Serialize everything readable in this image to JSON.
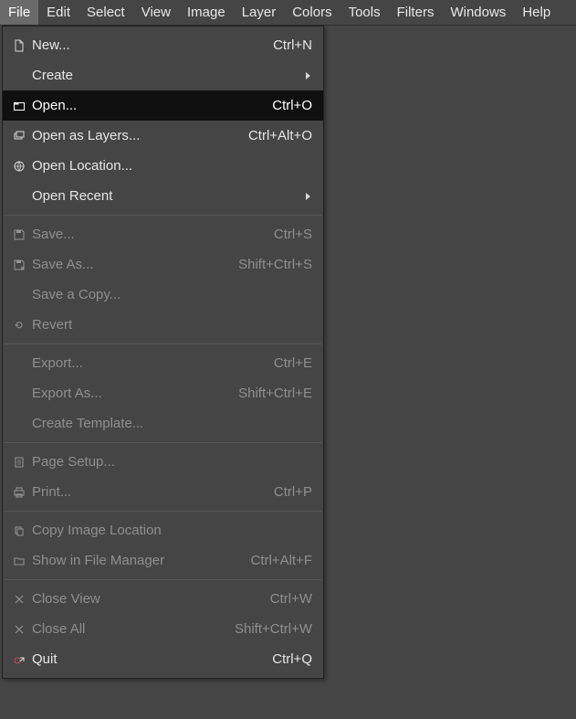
{
  "menubar": {
    "items": [
      {
        "label": "File"
      },
      {
        "label": "Edit"
      },
      {
        "label": "Select"
      },
      {
        "label": "View"
      },
      {
        "label": "Image"
      },
      {
        "label": "Layer"
      },
      {
        "label": "Colors"
      },
      {
        "label": "Tools"
      },
      {
        "label": "Filters"
      },
      {
        "label": "Windows"
      },
      {
        "label": "Help"
      }
    ],
    "active_index": 0
  },
  "file_menu": {
    "new": {
      "label": "New...",
      "accel": "Ctrl+N"
    },
    "create": {
      "label": "Create"
    },
    "open": {
      "label": "Open...",
      "accel": "Ctrl+O"
    },
    "open_as_layers": {
      "label": "Open as Layers...",
      "accel": "Ctrl+Alt+O"
    },
    "open_location": {
      "label": "Open Location..."
    },
    "open_recent": {
      "label": "Open Recent"
    },
    "save": {
      "label": "Save...",
      "accel": "Ctrl+S"
    },
    "save_as": {
      "label": "Save As...",
      "accel": "Shift+Ctrl+S"
    },
    "save_a_copy": {
      "label": "Save a Copy..."
    },
    "revert": {
      "label": "Revert"
    },
    "export": {
      "label": "Export...",
      "accel": "Ctrl+E"
    },
    "export_as": {
      "label": "Export As...",
      "accel": "Shift+Ctrl+E"
    },
    "create_template": {
      "label": "Create Template..."
    },
    "page_setup": {
      "label": "Page Setup..."
    },
    "print": {
      "label": "Print...",
      "accel": "Ctrl+P"
    },
    "copy_image_location": {
      "label": "Copy Image Location"
    },
    "show_in_file_manager": {
      "label": "Show in File Manager",
      "accel": "Ctrl+Alt+F"
    },
    "close_view": {
      "label": "Close View",
      "accel": "Ctrl+W"
    },
    "close_all": {
      "label": "Close All",
      "accel": "Shift+Ctrl+W"
    },
    "quit": {
      "label": "Quit",
      "accel": "Ctrl+Q"
    }
  }
}
